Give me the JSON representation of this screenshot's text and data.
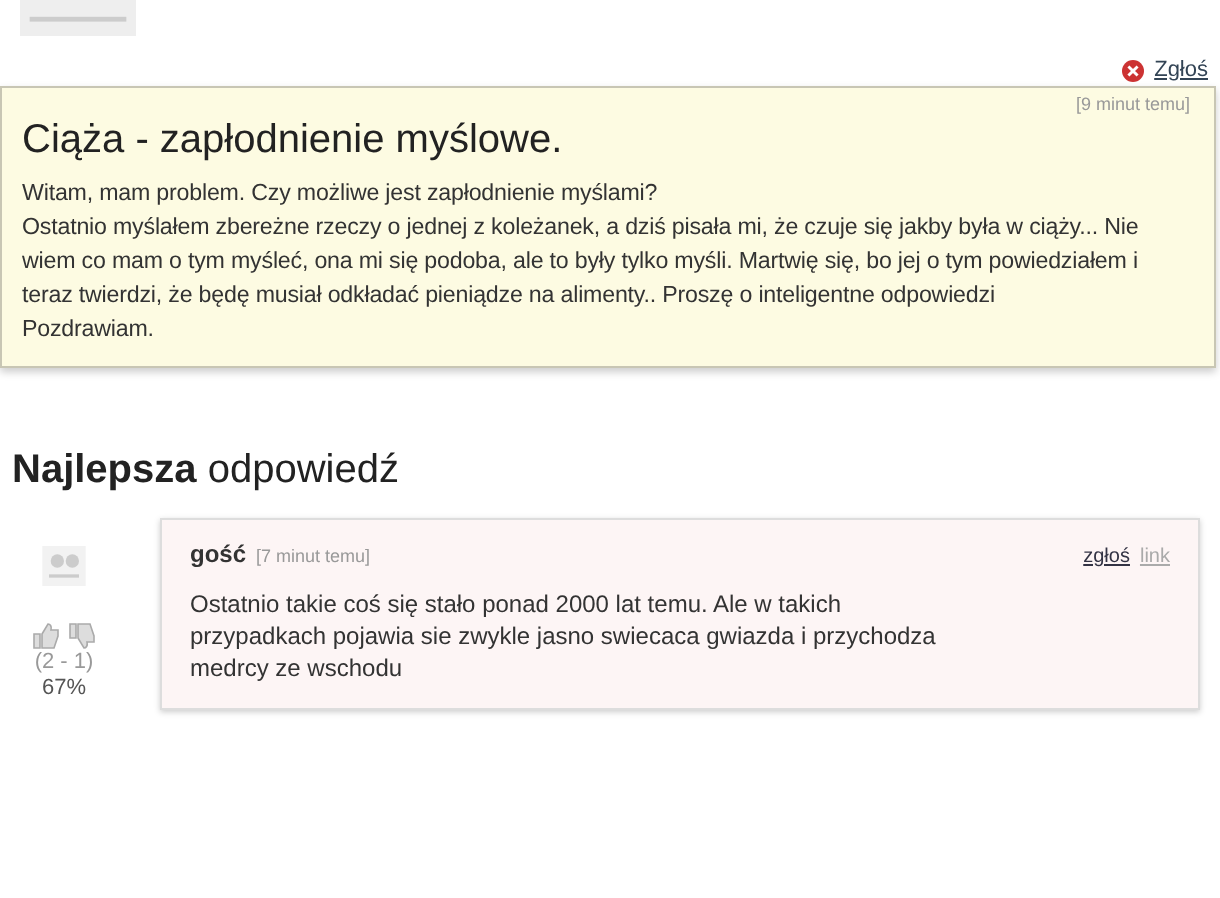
{
  "question": {
    "report": "Zgłoś",
    "time": "[9 minut temu]",
    "title": "Ciąża - zapłodnienie myślowe.",
    "body": [
      "Witam, mam problem. Czy możliwe jest zapłodnienie myślami?",
      "Ostatnio myślałem zbereżne rzeczy o jednej z koleżanek, a dziś pisała mi, że czuje się jakby była w ciąży... Nie wiem co mam o tym myśleć, ona mi się podoba, ale to były tylko myśli. Martwię się, bo jej o tym powiedziałem i teraz twierdzi, że będę musiał odkładać pieniądze na alimenty.. Proszę o inteligentne odpowiedzi",
      "Pozdrawiam."
    ]
  },
  "best_heading": {
    "bold": "Najlepsza",
    "rest": "odpowiedź"
  },
  "answer": {
    "votes": "(2 - 1)",
    "percent": "67%",
    "author": "gość",
    "time": "[7 minut temu]",
    "report": "zgłoś",
    "link": "link",
    "body": "Ostatnio takie coś się stało ponad 2000 lat temu. Ale w takich przypadkach pojawia sie zwykle jasno swiecaca gwiazda i przychodza medrcy ze wschodu"
  }
}
